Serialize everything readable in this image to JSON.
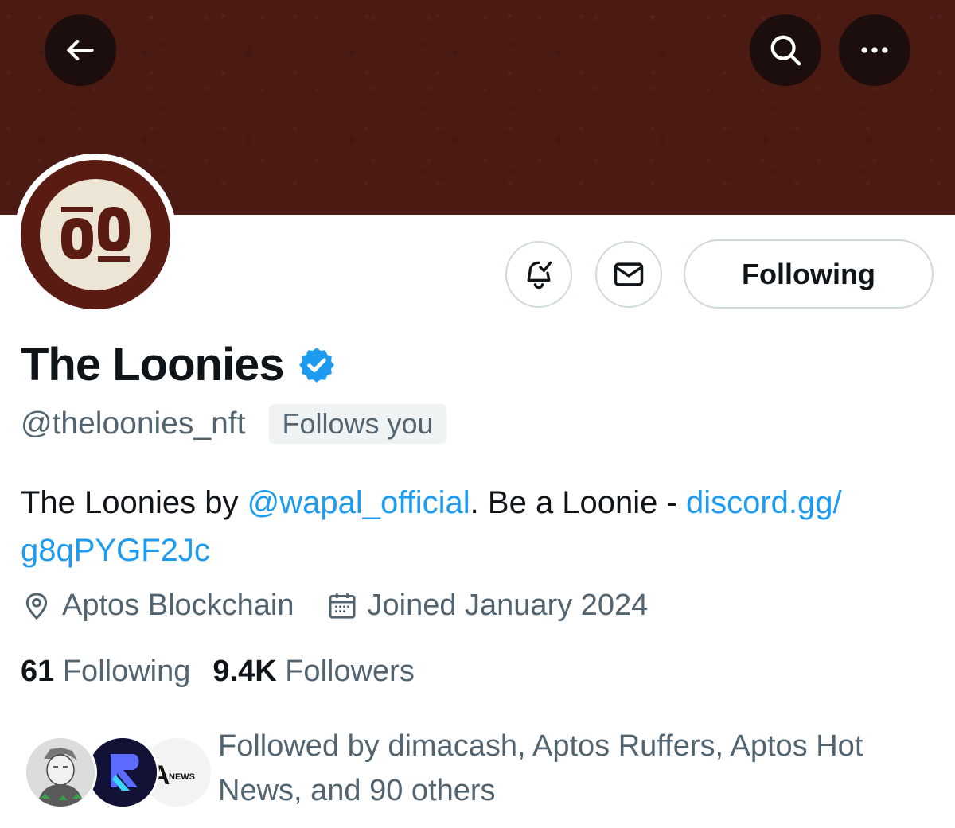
{
  "header": {
    "back_icon": "arrow-left-icon",
    "search_icon": "search-icon",
    "more_icon": "more-horizontal-icon",
    "banner_color": "#4a1a13"
  },
  "profile": {
    "avatar_text": "ŌO",
    "display_name": "The Loonies",
    "verified_color": "#1d9bf0",
    "handle": "@theloonies_nft",
    "follows_you": "Follows you",
    "following_button": "Following",
    "bio": {
      "part1": "The Loonies by ",
      "mention": "@wapal_official",
      "part2": ". Be a Loonie - ",
      "link_line1": "discord.gg/",
      "link_line2": "g8qPYGF2Jc"
    },
    "location": "Aptos Blockchain",
    "joined": "Joined January 2024",
    "following_count": "61",
    "following_label": "Following",
    "followers_count": "9.4K",
    "followers_label": "Followers",
    "followed_by_line1": "Followed by dimacash, Aptos Ruffers, Aptos Hot",
    "followed_by_line2": "News, and 90 others",
    "news_avatar_text": "NEWS",
    "news_avatar_letter": "A"
  },
  "colors": {
    "accent": "#1d9bf0",
    "muted_text": "#536471",
    "primary_text": "#0f1419"
  }
}
